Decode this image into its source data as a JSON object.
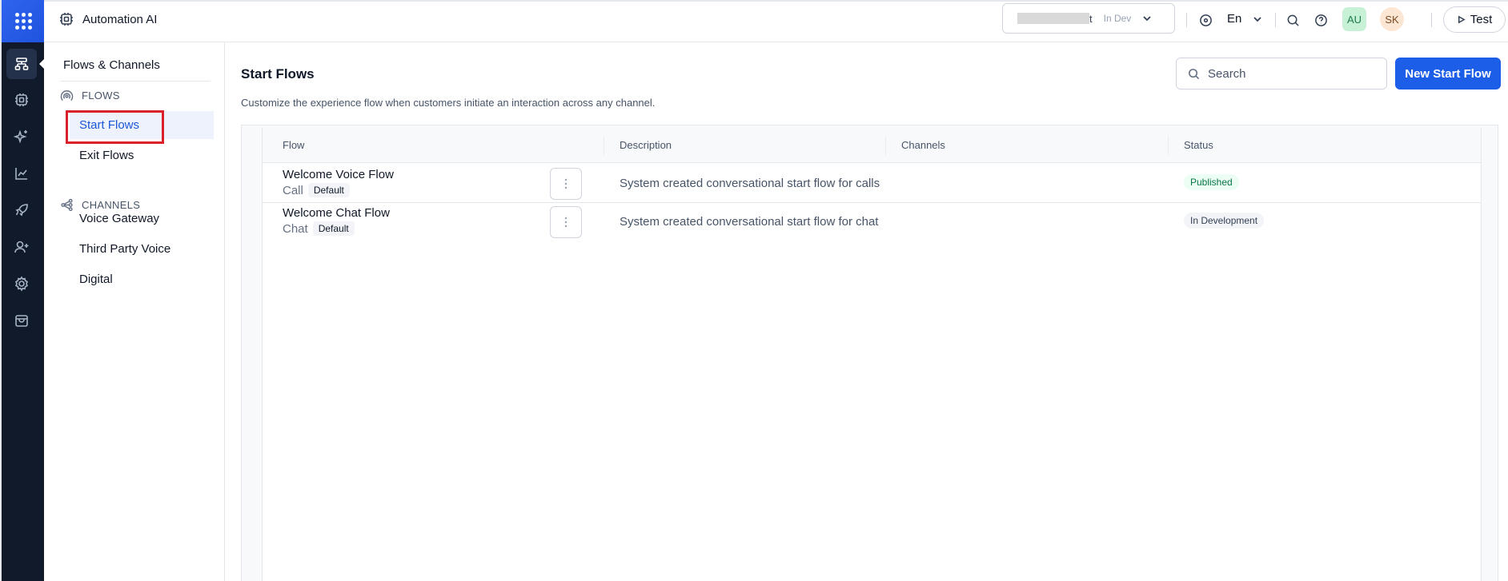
{
  "app": {
    "name": "Automation AI"
  },
  "topbar": {
    "environment": {
      "name_suffix": "t",
      "tag": "In Dev"
    },
    "language": "En",
    "avatars": [
      "AU",
      "SK"
    ],
    "test_label": "Test"
  },
  "subnav": {
    "title": "Flows & Channels",
    "flows_heading": "FLOWS",
    "flows_items": [
      "Start Flows",
      "Exit Flows"
    ],
    "channels_heading": "CHANNELS",
    "channels_items": [
      "Voice Gateway",
      "Third Party Voice",
      "Digital"
    ]
  },
  "main": {
    "title": "Start Flows",
    "subtitle": "Customize the experience flow when customers initiate an interaction across any channel.",
    "search_placeholder": "Search",
    "new_button": "New Start Flow",
    "columns": [
      "Flow",
      "Description",
      "Channels",
      "Status"
    ],
    "rows": [
      {
        "name": "Welcome Voice Flow",
        "type": "Call",
        "badge": "Default",
        "description": "System created conversational start flow for calls",
        "channels": "",
        "status": "Published"
      },
      {
        "name": "Welcome Chat Flow",
        "type": "Chat",
        "badge": "Default",
        "description": "System created conversational start flow for chat",
        "channels": "",
        "status": "In Development"
      }
    ]
  },
  "colors": {
    "accent": "#1d5ee8",
    "rail_bg": "#111a2b",
    "highlight": "#d9202b"
  },
  "icons": {
    "rail": [
      "app-grid-icon",
      "flows-icon",
      "bot-chip-icon",
      "sparkle-icon",
      "analytics-icon",
      "rocket-icon",
      "user-add-icon",
      "settings-icon",
      "store-icon"
    ],
    "topbar": [
      "chip-icon",
      "chevron-down-icon",
      "target-icon",
      "search-icon",
      "help-icon",
      "play-icon"
    ]
  }
}
